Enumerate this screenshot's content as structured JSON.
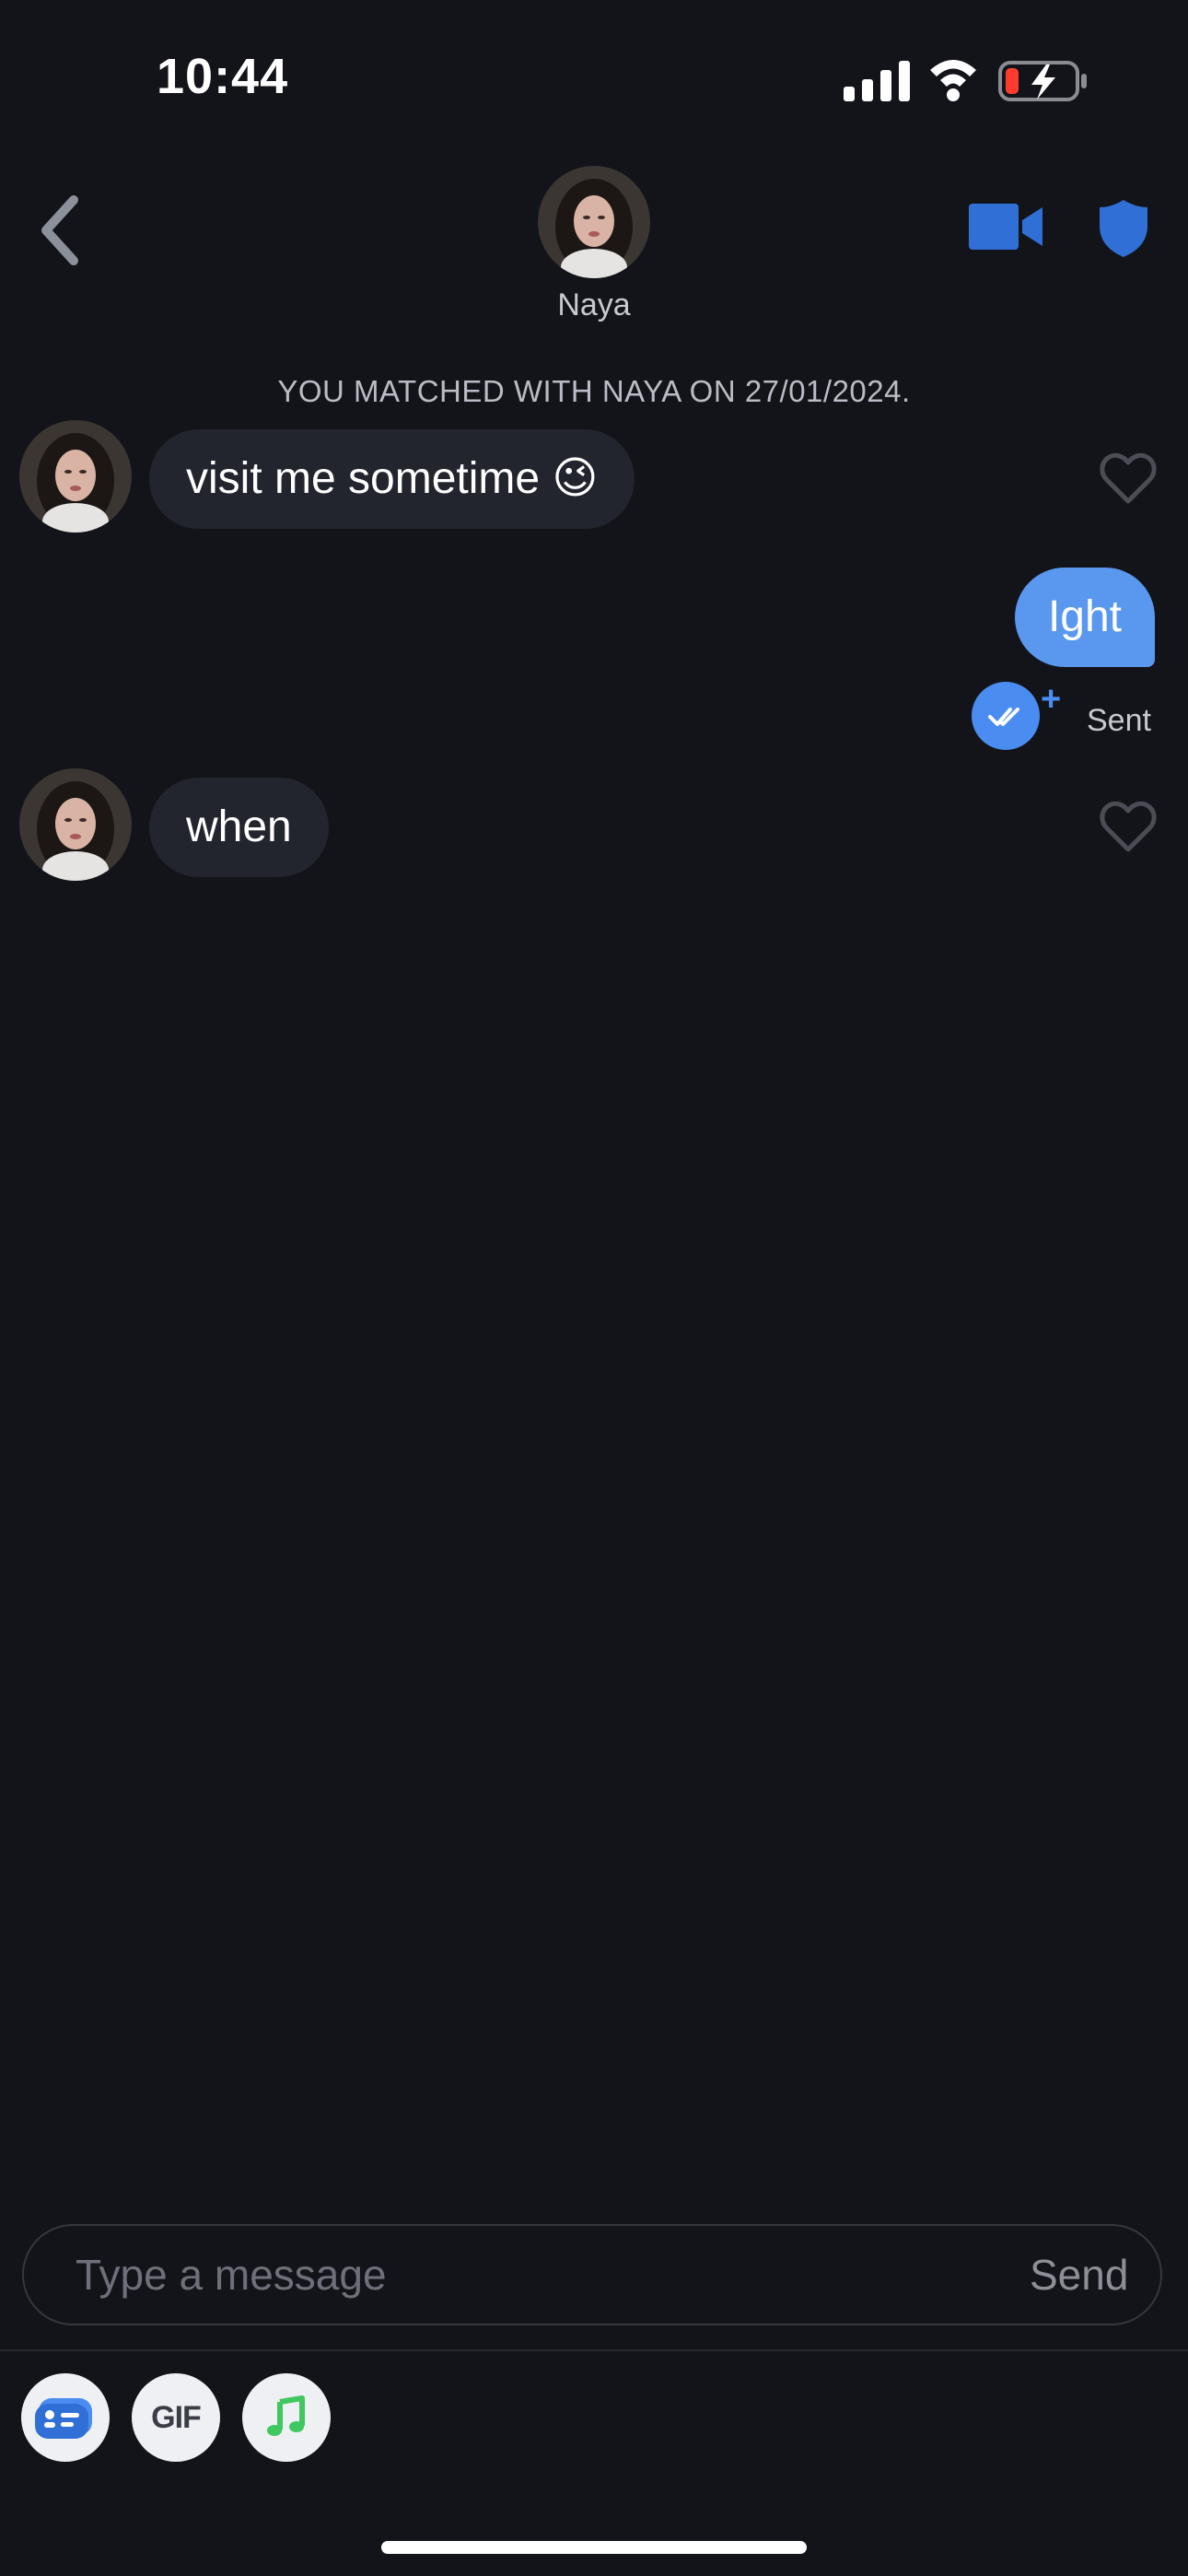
{
  "status_bar": {
    "time": "10:44"
  },
  "header": {
    "contact_name": "Naya",
    "back_icon": "chevron-left-icon",
    "video_icon": "video-camera-icon",
    "safety_icon": "shield-icon"
  },
  "chat": {
    "match_banner": "YOU MATCHED WITH NAYA ON 27/01/2024.",
    "messages": [
      {
        "direction": "incoming",
        "text": "visit me sometime 😉"
      },
      {
        "direction": "outgoing",
        "text": "Ight",
        "status": "Sent"
      },
      {
        "direction": "incoming",
        "text": "when"
      }
    ]
  },
  "composer": {
    "placeholder": "Type a message",
    "send_label": "Send",
    "tools": [
      {
        "icon": "sticker-card-icon"
      },
      {
        "label": "GIF"
      },
      {
        "icon": "music-note-icon"
      }
    ]
  },
  "colors": {
    "background": "#131419",
    "incoming_bubble": "#22252d",
    "outgoing_bubble": "#5a98f0",
    "accent_blue": "#2f6fd6"
  }
}
